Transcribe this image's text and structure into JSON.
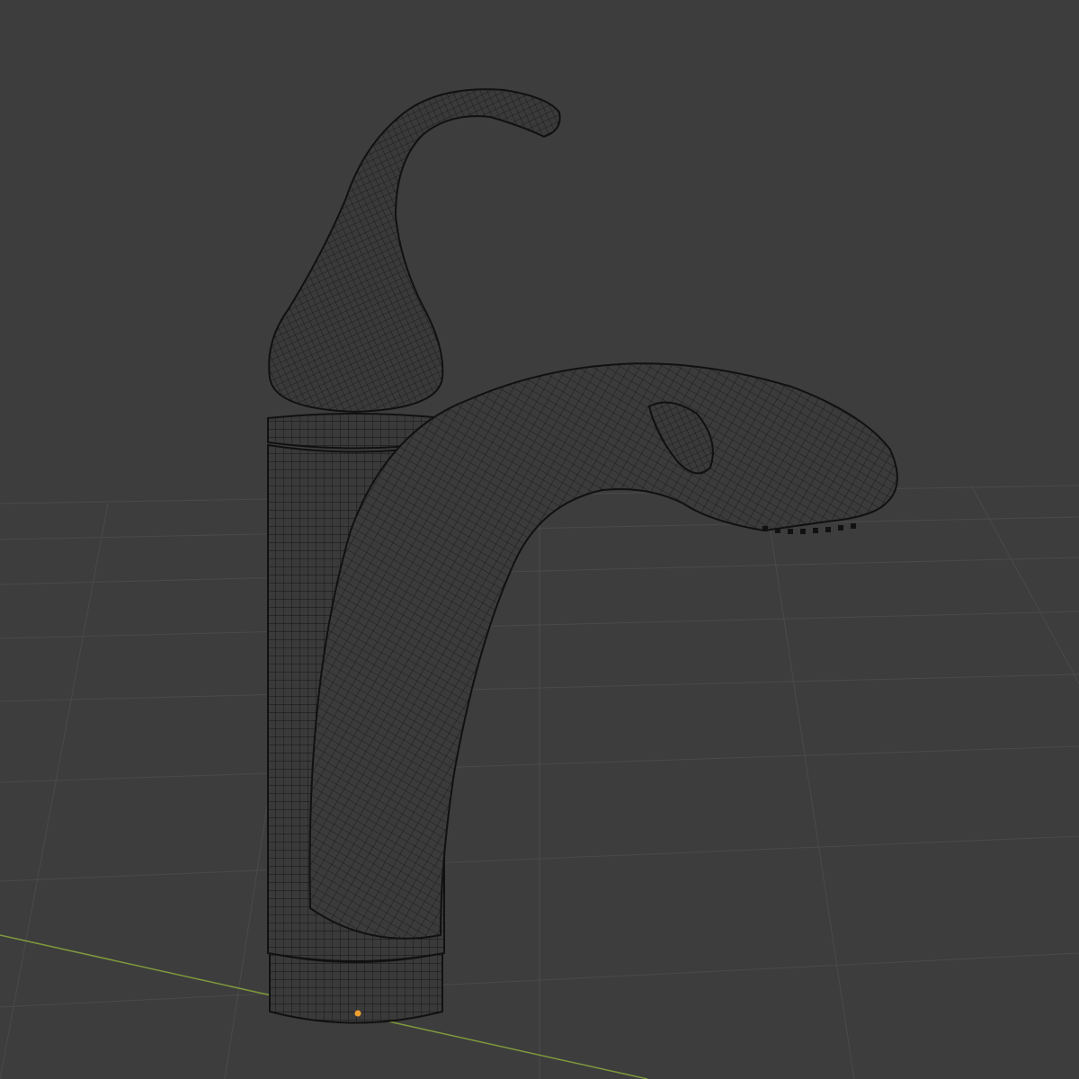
{
  "viewport": {
    "background_color": "#3d3d3d",
    "grid_color": "#4a4a4a",
    "x_axis_color": "#7f9a3c",
    "wire_color": "#111111",
    "mesh_fill_color": "#3a3a3a",
    "origin_color": "#f0a030",
    "object": "faucet-wireframe-mesh"
  }
}
